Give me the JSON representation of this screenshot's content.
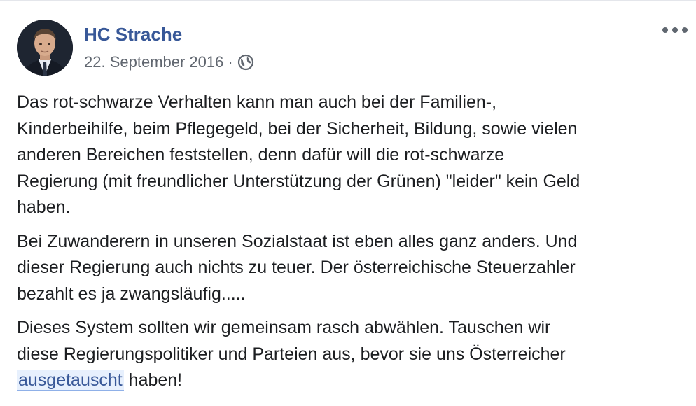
{
  "post": {
    "author": "HC Strache",
    "date": "22. September 2016",
    "separator": "·",
    "privacy_icon": "globe-icon",
    "more_icon": "more-options-icon",
    "paragraphs": [
      {
        "lines": [
          "Das rot-schwarze Verhalten kann man auch bei der Familien-,",
          "Kinderbeihilfe, beim Pflegegeld, bei der Sicherheit, Bildung, sowie vielen",
          "anderen Bereichen feststellen, denn dafür will die rot-schwarze",
          "Regierung (mit freundlicher Unterstützung der Grünen) \"leider\" kein Geld",
          "haben."
        ]
      },
      {
        "lines": [
          "Bei Zuwanderern in unseren Sozialstaat ist eben alles ganz anders. Und",
          "dieser Regierung auch nichts zu teuer. Der österreichische Steuerzahler",
          "bezahlt es ja zwangsläufig....."
        ]
      },
      {
        "lines": [
          "Dieses System sollten wir gemeinsam rasch abwählen. Tauschen wir",
          "diese Regierungspolitiker und Parteien aus, bevor sie uns Österreicher"
        ],
        "last_link": "ausgetauscht",
        "last_rest": " haben!"
      }
    ]
  }
}
